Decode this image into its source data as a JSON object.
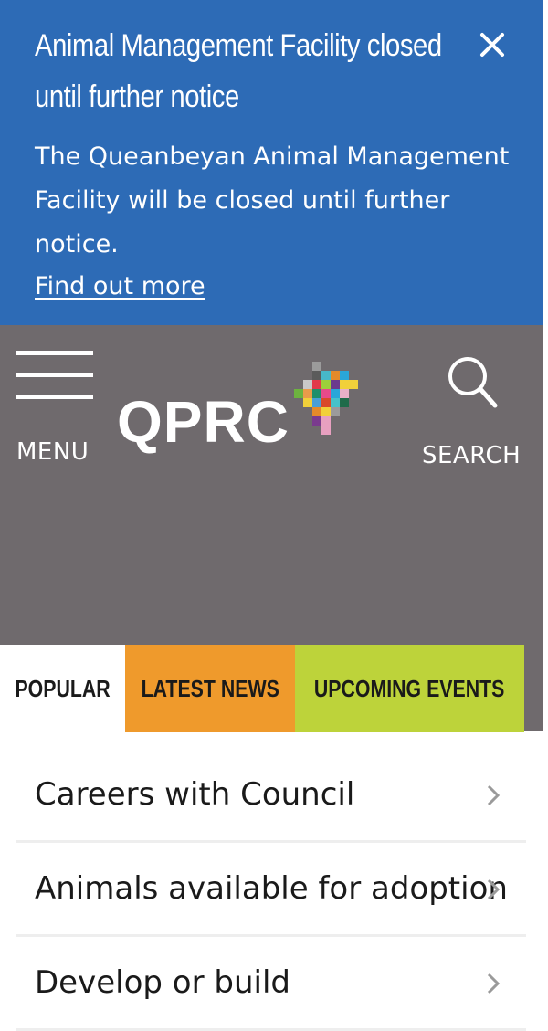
{
  "alert": {
    "title_line1": "Animal Management Facility closed",
    "title_line2": "until further notice",
    "body": "The Queanbeyan Animal Management Facility will be closed until further notice.",
    "link": "Find out more",
    "close_icon": "close-icon"
  },
  "header": {
    "menu_label": "MENU",
    "menu_icon": "hamburger-menu-icon",
    "logo_text": "QPRC",
    "search_label": "SEARCH",
    "search_icon": "search-icon",
    "background": "#6f6a6d"
  },
  "tabs": [
    {
      "label": "POPULAR",
      "color": "#ffffff"
    },
    {
      "label": "LATEST NEWS",
      "color": "#ef9a2c"
    },
    {
      "label": "UPCOMING EVENTS",
      "color": "#bdd33a"
    }
  ],
  "links": [
    {
      "label": "Careers with Council"
    },
    {
      "label": "Animals available for adoption"
    },
    {
      "label": "Develop or build"
    }
  ],
  "colors": {
    "alert_blue": "#2d6bb6",
    "text_dark": "#1a1a1a",
    "chevron": "#9a9a9a"
  }
}
